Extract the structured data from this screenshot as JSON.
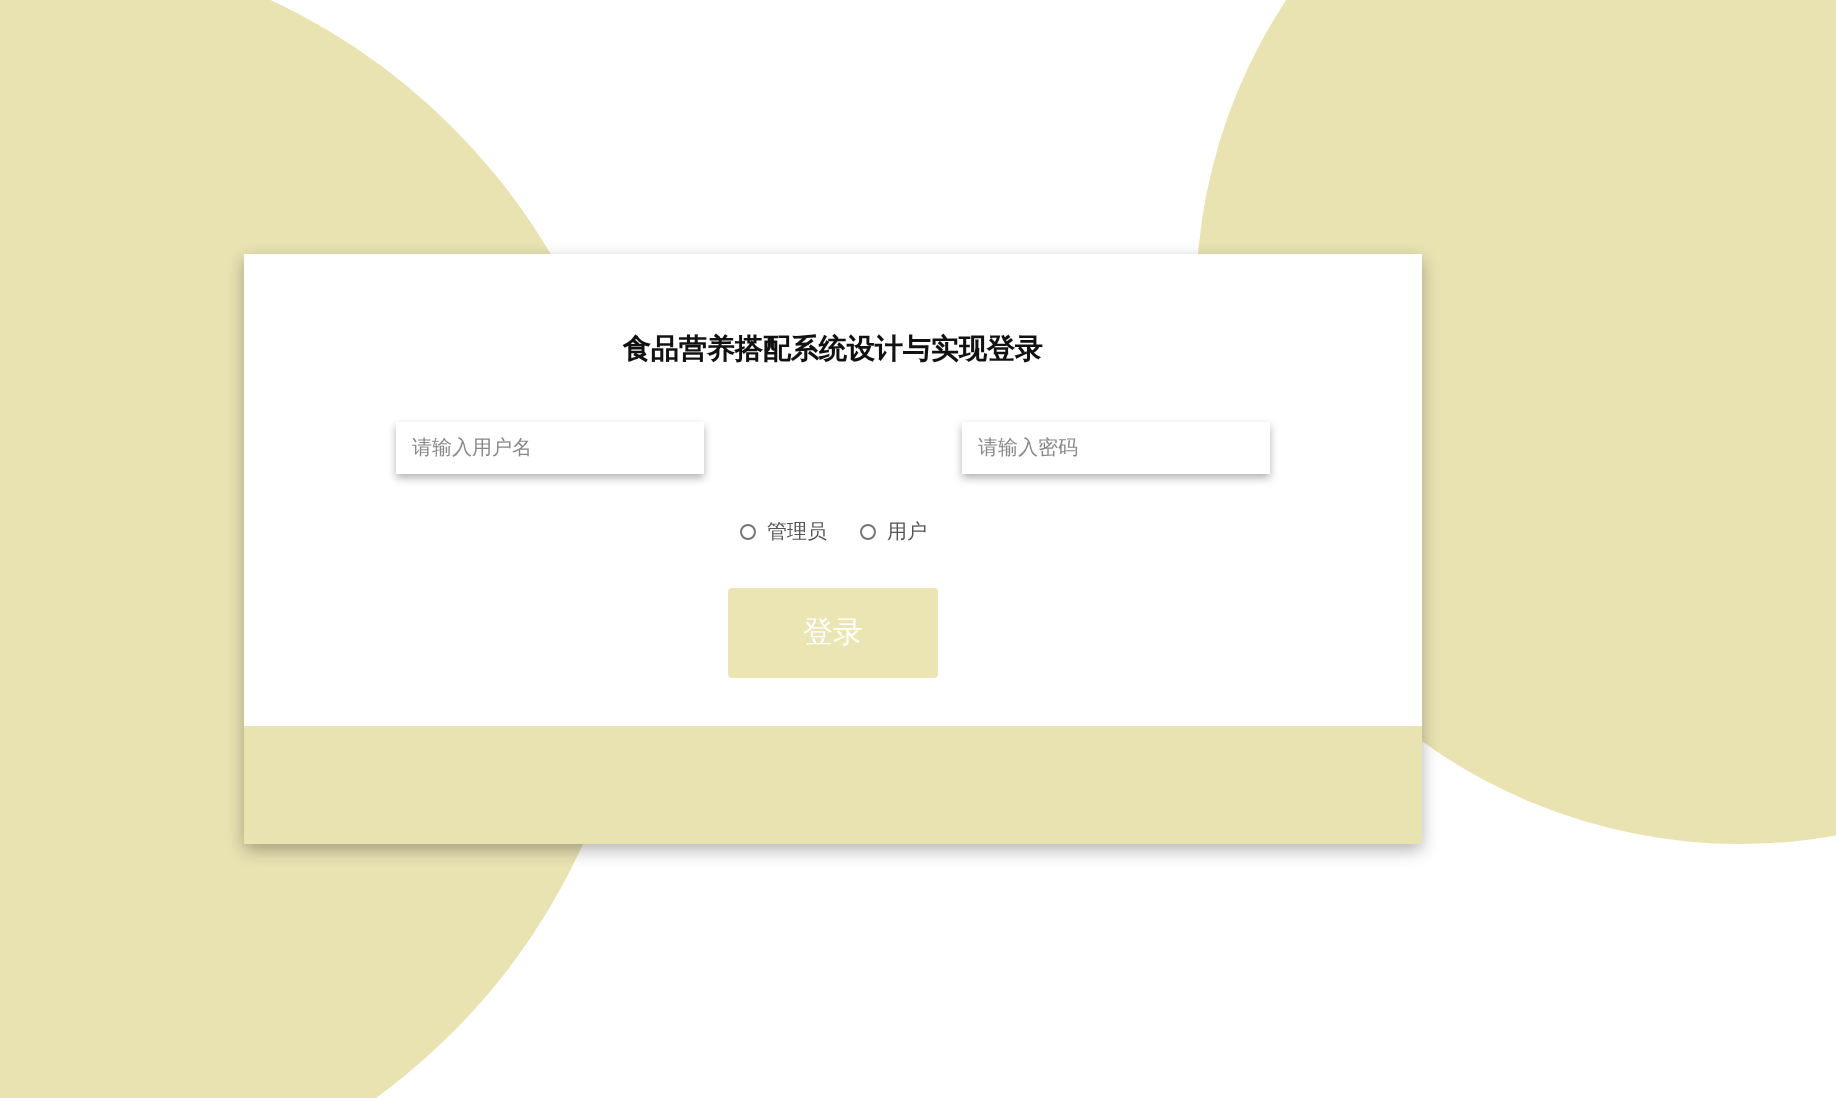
{
  "title": "食品营养搭配系统设计与实现登录",
  "fields": [
    {
      "placeholder": "请输入用户名"
    },
    {
      "placeholder": "请输入密码"
    }
  ],
  "roles": [
    {
      "label": "管理员",
      "selected": false
    },
    {
      "label": "用户",
      "selected": false
    }
  ],
  "login_button": "登录"
}
